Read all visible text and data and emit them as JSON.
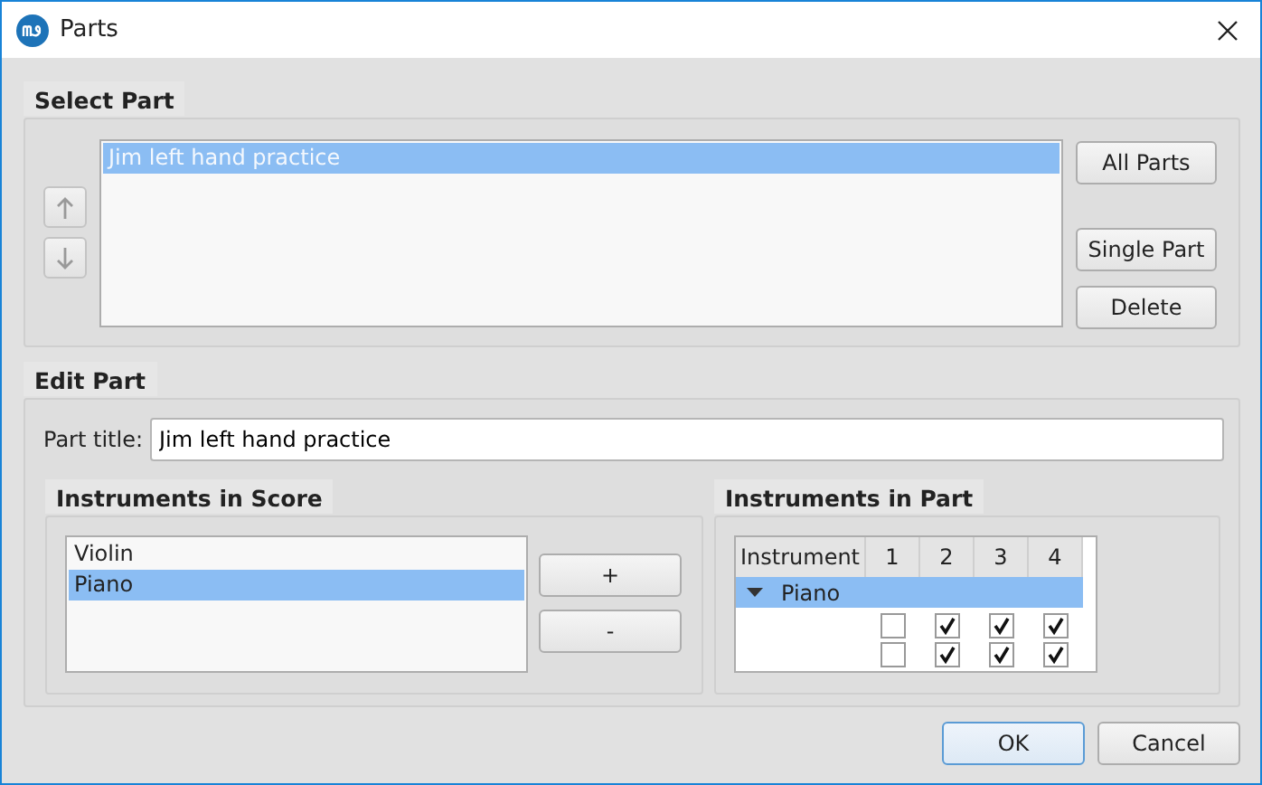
{
  "window": {
    "title": "Parts"
  },
  "select_part": {
    "title": "Select Part",
    "parts": [
      {
        "label": "Jim left hand practice",
        "selected": true
      }
    ],
    "buttons": [
      "All Parts",
      "Single Part",
      "Delete"
    ]
  },
  "edit_part": {
    "title": "Edit Part",
    "part_title_label": "Part title:",
    "part_title_value": "Jim left hand practice",
    "instruments_in_score": {
      "title": "Instruments in Score",
      "items": [
        {
          "label": "Violin",
          "selected": false
        },
        {
          "label": "Piano",
          "selected": true
        }
      ],
      "buttons": [
        "+",
        "-"
      ]
    },
    "instruments_in_part": {
      "title": "Instruments in Part",
      "columns": [
        "Instrument",
        "1",
        "2",
        "3",
        "4"
      ],
      "rows": [
        {
          "label": "Piano",
          "expanded": true,
          "selected": true,
          "staves": [
            {
              "checks": [
                false,
                true,
                true,
                true
              ]
            },
            {
              "checks": [
                false,
                true,
                true,
                true
              ]
            }
          ]
        }
      ]
    }
  },
  "footer_buttons": [
    {
      "label": "OK",
      "default": true
    },
    {
      "label": "Cancel",
      "default": false
    }
  ]
}
